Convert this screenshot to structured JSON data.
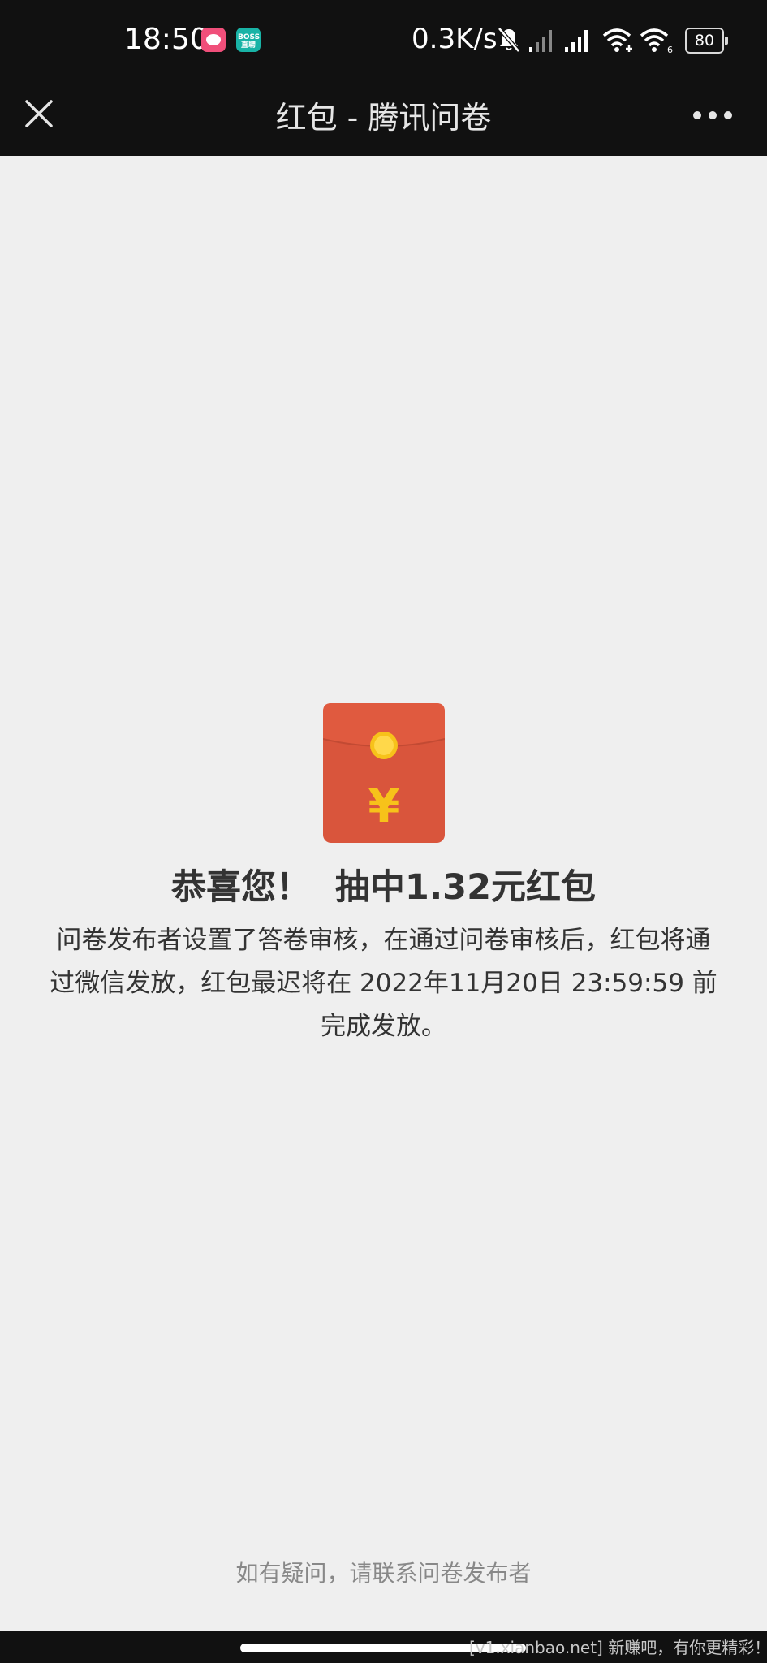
{
  "status_bar": {
    "time": "18:50",
    "app_icon_boss_label": "BOSS直聘",
    "net_speed": "0.3K/s",
    "battery_level": "80",
    "icons": [
      "heart-app-icon",
      "boss-app-icon",
      "mute-icon",
      "signal-icon",
      "signal-icon",
      "wifi-icon",
      "wifi-6-icon",
      "battery-icon"
    ]
  },
  "nav": {
    "title": "红包 - 腾讯问卷",
    "close_icon": "close-icon",
    "more_icon": "more-dots-icon"
  },
  "result": {
    "envelope_icon": "red-envelope-icon",
    "currency_symbol": "¥",
    "headline": "恭喜您！  抽中1.32元红包",
    "description": "问卷发布者设置了答卷审核，在通过问卷审核后，红包将通过微信发放，红包最迟将在 2022年11月20日 23:59:59 前完成发放。"
  },
  "footer": {
    "help_text": "如有疑问，请联系问卷发布者"
  },
  "bottom": {
    "watermark": "[v1.xianbao.net] 新赚吧，有你更精彩！"
  },
  "colors": {
    "envelope_red": "#e05a3f",
    "envelope_flap": "#d9553c",
    "coin_gold": "#f7c21a",
    "page_bg": "#efefef",
    "bar_bg": "#111111"
  }
}
